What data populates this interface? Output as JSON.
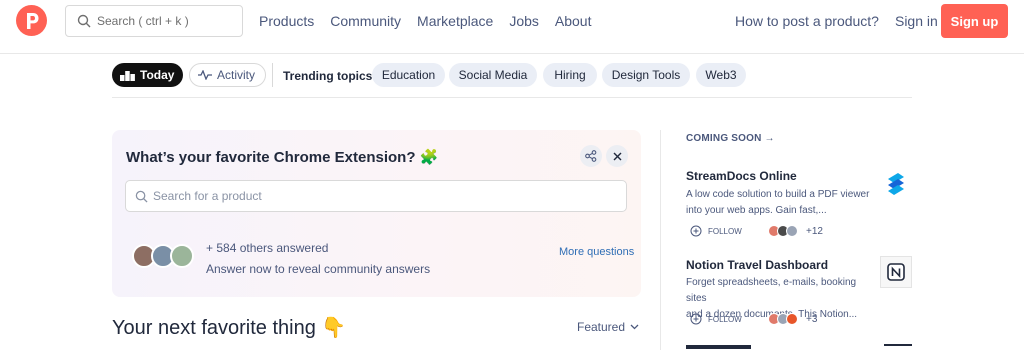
{
  "header": {
    "search_placeholder": "Search ( ctrl + k )",
    "nav": [
      "Products",
      "Community",
      "Marketplace",
      "Jobs",
      "About"
    ],
    "how_to": "How to post a product?",
    "sign_in": "Sign in",
    "sign_up": "Sign up",
    "brand_color": "#ff6154"
  },
  "topics_bar": {
    "today": "Today",
    "activity": "Activity",
    "trending_label": "Trending topics:",
    "topics": [
      "Education",
      "Social Media",
      "Hiring",
      "Design Tools",
      "Web3"
    ]
  },
  "question_card": {
    "title": "What’s your favorite Chrome Extension? 🧩",
    "search_placeholder": "Search for a product",
    "answered": "+ 584 others answered",
    "reveal": "Answer now to reveal community answers",
    "more": "More questions"
  },
  "feed": {
    "heading": "Your next favorite thing 👇",
    "sort": "Featured"
  },
  "sidebar": {
    "coming_soon": "COMING SOON →",
    "items": [
      {
        "title": "StreamDocs Online",
        "desc_line1": "A low code solution to build a PDF viewer",
        "desc_line2": "into your web apps. Gain fast,...",
        "follow": "FOLLOW",
        "count": "+12",
        "icon": "streamdocs-logo"
      },
      {
        "title": "Notion Travel Dashboard",
        "desc_line1": "Forget spreadsheets, e-mails, booking sites",
        "desc_line2": "and a dozen documents. This Notion...",
        "follow": "FOLLOW",
        "count": "+3",
        "icon": "notion-logo"
      }
    ]
  }
}
